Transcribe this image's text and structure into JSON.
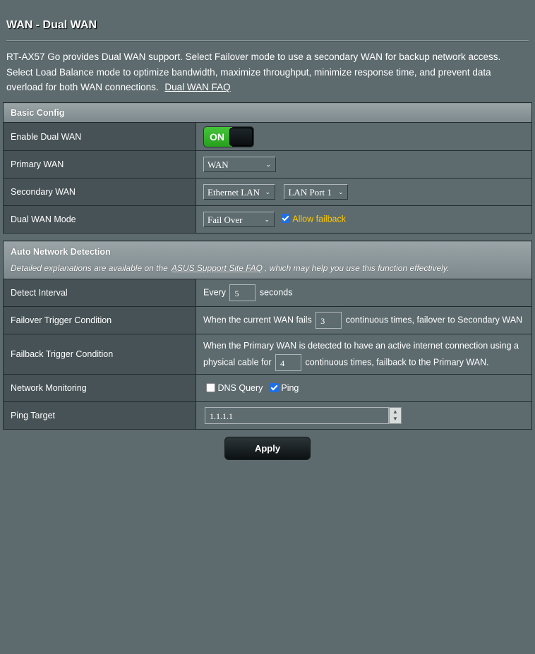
{
  "page": {
    "title": "WAN - Dual WAN",
    "description": "RT-AX57 Go provides Dual WAN support. Select Failover mode to use a secondary WAN for backup network access. Select Load Balance mode to optimize bandwidth, maximize throughput, minimize response time, and prevent data overload for both WAN connections.",
    "faq_link": "Dual WAN FAQ"
  },
  "basic_config": {
    "header": "Basic Config",
    "enable_dual_wan": {
      "label": "Enable Dual WAN",
      "toggle": "ON"
    },
    "primary_wan": {
      "label": "Primary WAN",
      "value": "WAN"
    },
    "secondary_wan": {
      "label": "Secondary WAN",
      "value": "Ethernet LAN",
      "port": "LAN Port 1"
    },
    "dual_wan_mode": {
      "label": "Dual WAN Mode",
      "value": "Fail Over",
      "allow_failback": "Allow failback"
    }
  },
  "auto_detect": {
    "header": "Auto Network Detection",
    "note_pre": "Detailed explanations are available on the",
    "note_link": "ASUS Support Site FAQ",
    "note_post": ", which may help you use this function effectively.",
    "detect_interval": {
      "label": "Detect Interval",
      "pre": "Every",
      "value": "5",
      "post": "seconds"
    },
    "failover": {
      "label": "Failover Trigger Condition",
      "pre": "When the current WAN fails",
      "value": "3",
      "post": "continuous times, failover to Secondary WAN"
    },
    "failback": {
      "label": "Failback Trigger Condition",
      "line1": "When the Primary WAN is detected to have an active internet connection using a",
      "pre": "physical cable for",
      "value": "4",
      "post": "continuous times, failback to the Primary WAN."
    },
    "monitoring": {
      "label": "Network Monitoring",
      "dns": "DNS Query",
      "ping": "Ping"
    },
    "ping_target": {
      "label": "Ping Target",
      "value": "1.1.1.1"
    }
  },
  "actions": {
    "apply": "Apply"
  },
  "colors": {
    "toggle_on": "#2fb32a",
    "accent_yellow": "#ffcc00",
    "checkbox": "#1f6fe5"
  }
}
